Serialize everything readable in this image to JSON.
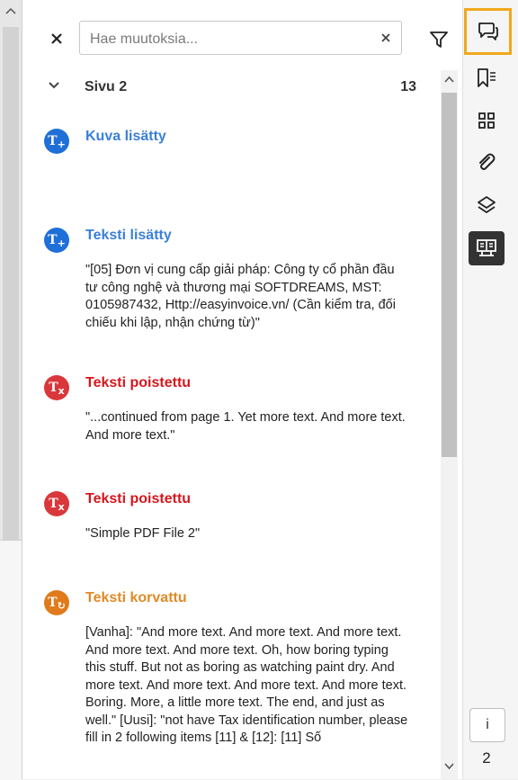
{
  "search": {
    "placeholder": "Hae muutoksia..."
  },
  "group": {
    "title": "Sivu 2",
    "count": "13"
  },
  "items": [
    {
      "type": "added",
      "badge": "T",
      "title": "Kuva lisätty",
      "body": ""
    },
    {
      "type": "added",
      "badge": "T",
      "title": "Teksti lisätty",
      "body": "\"[05] Đơn vị cung cấp giải pháp: Công ty cổ phần đầu tư công nghệ và thương mại SOFTDREAMS, MST: 0105987432, Http://easyinvoice.vn/ (Cần kiểm tra, đối chiếu khi lập, nhận chứng từ)\""
    },
    {
      "type": "deleted",
      "badge": "T",
      "title": "Teksti poistettu",
      "body": "\"...continued from page 1. Yet more text. And more text. And more text.\""
    },
    {
      "type": "deleted",
      "badge": "T",
      "title": "Teksti poistettu",
      "body": "\"Simple PDF File 2\""
    },
    {
      "type": "replaced",
      "badge": "T",
      "title": "Teksti korvattu",
      "body": "[Vanha]: \"And more text. And more text. And more text. And more text. And more  text. Oh, how boring typing this stuff. But not as boring as watching  paint dry. And more text. And more text. And more text. And more text.  Boring. More, a little more text. The end, and just as well.\" [Uusi]: \"not have Tax identification number, please fill in 2 following items [11] & [12]: [11] Số"
    }
  ],
  "toolbar": {
    "icons": [
      "comments-icon",
      "bookmarks-icon",
      "thumbnails-icon",
      "attachments-icon",
      "layers-icon",
      "compare-icon"
    ],
    "info_label": "i",
    "page_number": "2"
  },
  "colors": {
    "added": "#1f6fd8",
    "deleted": "#d9373b",
    "replaced": "#e07a1a",
    "active_outline": "#f0a81c"
  }
}
